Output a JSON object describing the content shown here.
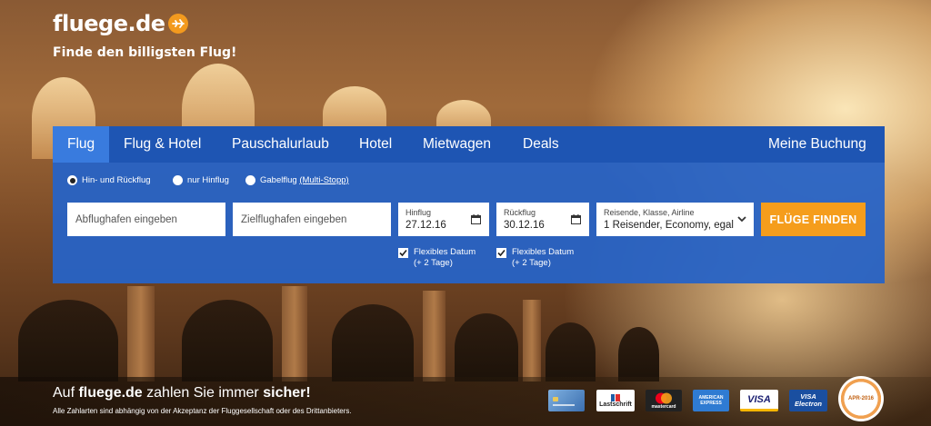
{
  "brand": {
    "logo_text": "fluege.de",
    "tagline": "Finde den billigsten Flug!",
    "accent_color": "#f59d1c",
    "panel_color": "#2663c7"
  },
  "tabs": [
    {
      "label": "Flug",
      "active": true
    },
    {
      "label": "Flug & Hotel",
      "active": false
    },
    {
      "label": "Pauschalurlaub",
      "active": false
    },
    {
      "label": "Hotel",
      "active": false
    },
    {
      "label": "Mietwagen",
      "active": false
    },
    {
      "label": "Deals",
      "active": false
    }
  ],
  "booking_link": "Meine Buchung",
  "trip_type": {
    "options": [
      {
        "label": "Hin- und Rückflug",
        "checked": true
      },
      {
        "label": "nur Hinflug",
        "checked": false
      },
      {
        "label": "Gabelflug",
        "checked": false,
        "suffix": "(Multi-Stopp)"
      }
    ]
  },
  "search": {
    "origin_placeholder": "Abflughafen eingeben",
    "destination_placeholder": "Zielflughafen eingeben",
    "outbound": {
      "label": "Hinflug",
      "value": "27.12.16"
    },
    "return": {
      "label": "Rückflug",
      "value": "30.12.16"
    },
    "travelers": {
      "label": "Reisende, Klasse, Airline",
      "value": "1 Reisender, Economy, egal"
    },
    "button_label": "FLÜGE FINDEN"
  },
  "flex_dates": [
    {
      "line1": "Flexibles Datum",
      "line2": "(+ 2 Tage)",
      "checked": true
    },
    {
      "line1": "Flexibles Datum",
      "line2": "(+ 2 Tage)",
      "checked": true
    }
  ],
  "footer": {
    "title_prefix": "Auf",
    "title_brand": "fluege.de",
    "title_middle": "zahlen Sie immer",
    "title_emphasis": "sicher!",
    "note": "Alle Zahlarten sind abhängig von der Akzeptanz der Fluggesellschaft oder des Drittanbieters."
  },
  "payment_methods": [
    {
      "name": "card-icon",
      "label": ""
    },
    {
      "name": "lastschrift-icon",
      "label": "Lastschrift"
    },
    {
      "name": "mastercard-icon",
      "label": "mastercard"
    },
    {
      "name": "amex-icon",
      "label": "AMERICAN EXPRESS"
    },
    {
      "name": "visa-icon",
      "label": "VISA"
    },
    {
      "name": "visa-electron-icon",
      "label": "VISA Electron"
    }
  ],
  "seal": {
    "text": "APR-2016"
  }
}
